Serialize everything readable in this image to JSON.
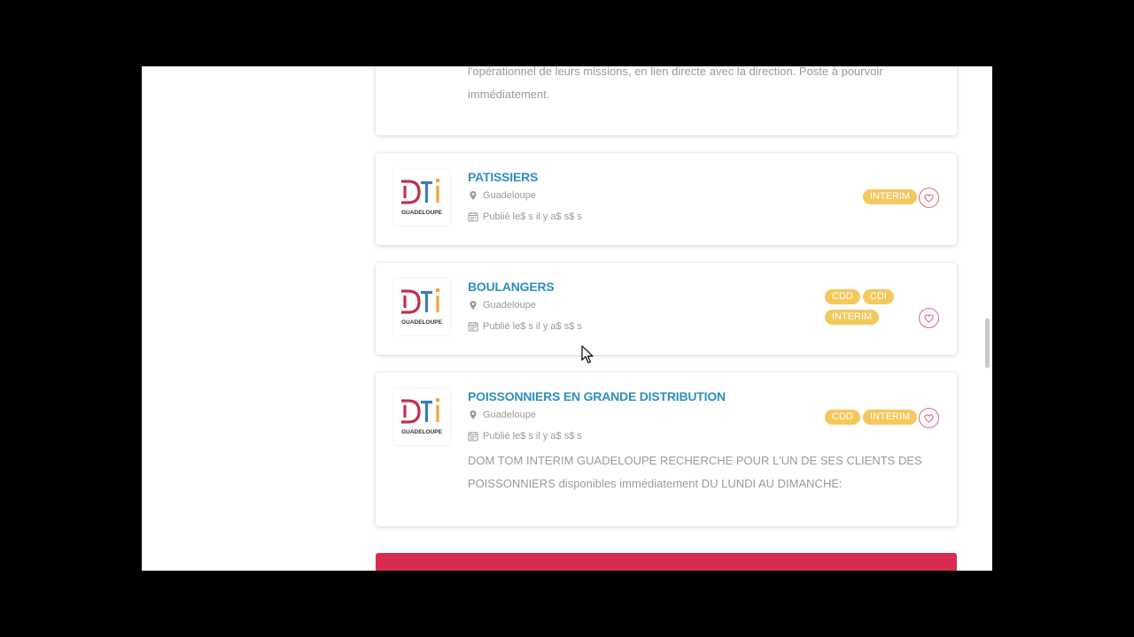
{
  "top_card": {
    "description": "l'opérationnel de leurs missions, en lien directe avec la direction. Poste à pourvoir immédiatement."
  },
  "logo_text": "GUADELOUPE",
  "colors": {
    "title_blue": "#2f8fbf",
    "badge_yellow": "#f3c85c",
    "heart_pink": "#e06a80",
    "banner_red": "#d92b51"
  },
  "jobs": [
    {
      "title": "PATISSIERS",
      "location": "Guadeloupe",
      "published": "Publié le$ s il y a$ s$ s",
      "badges": [
        "INTERIM"
      ]
    },
    {
      "title": "BOULANGERS",
      "location": "Guadeloupe",
      "published": "Publié le$ s il y a$ s$ s",
      "badges": [
        "CDD",
        "CDI",
        "INTERIM"
      ]
    },
    {
      "title": "POISSONNIERS EN GRANDE DISTRIBUTION",
      "location": "Guadeloupe",
      "published": "Publié le$ s il y a$ s$ s",
      "badges": [
        "CDD",
        "INTERIM"
      ],
      "description": "DOM TOM INTERIM GUADELOUPE RECHERCHE POUR L'UN DE SES CLIENTS DES POISSONNIERS disponibles immédiatement DU LUNDI AU DIMANCHE:"
    }
  ]
}
